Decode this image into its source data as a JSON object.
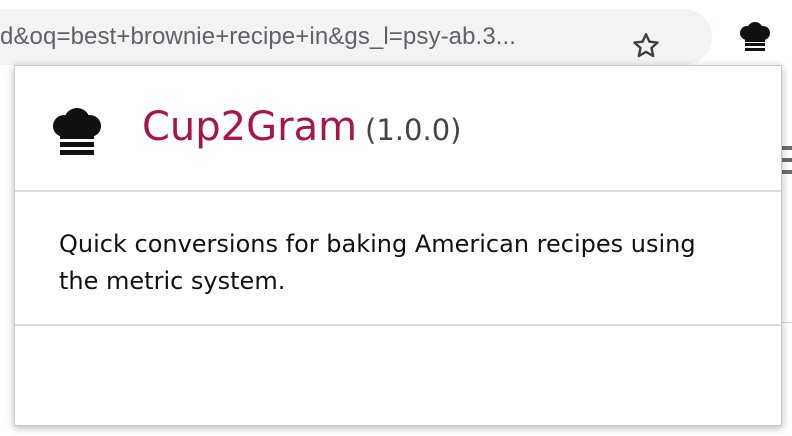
{
  "browser": {
    "url": "d&oq=best+brownie+recipe+in&gs_l=psy-ab.3...",
    "icons": {
      "bookmark": "star-icon",
      "extension": "chef-hat-icon"
    }
  },
  "popup": {
    "logo_icon": "chef-hat-icon",
    "app_name": "Cup2Gram",
    "version": "(1.0.0)",
    "description": "Quick conversions for baking American recipes using the metric system.",
    "colors": {
      "app_name": "#a8154b",
      "version": "#444444"
    }
  }
}
